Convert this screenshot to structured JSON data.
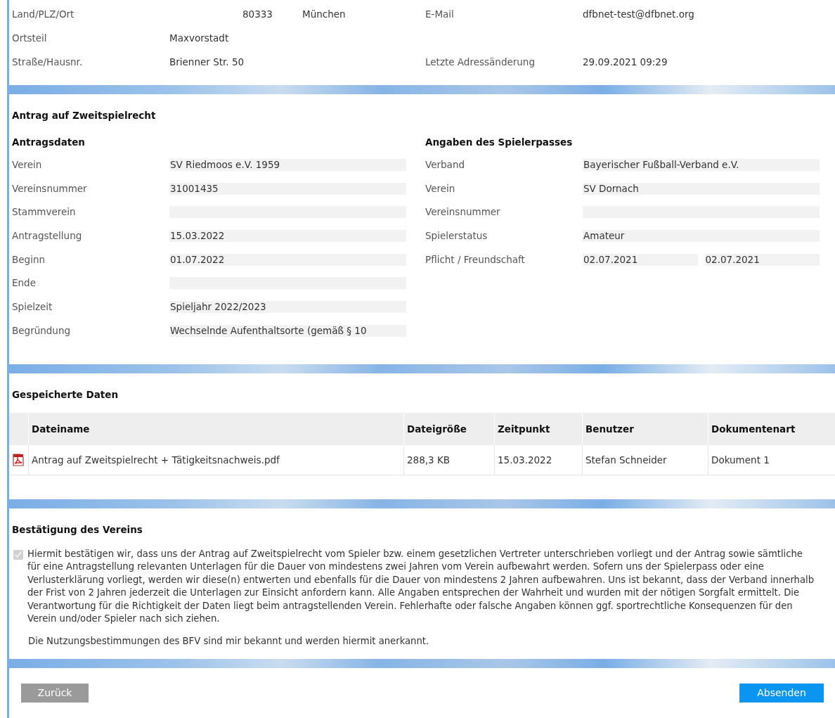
{
  "address": {
    "rows": [
      {
        "left": {
          "label": "Land/PLZ/Ort",
          "kind": "location",
          "zip": "80333",
          "city": "München"
        },
        "right": {
          "label": "E-Mail",
          "value": "dfbnet-test@dfbnet.org"
        }
      },
      {
        "left": {
          "label": "Ortsteil",
          "kind": "text",
          "value": "Maxvorstadt"
        }
      },
      {
        "left": {
          "label": "Straße/Hausnr.",
          "kind": "text",
          "value": "Brienner Str. 50"
        },
        "right": {
          "label": "Letzte Adressänderung",
          "value": "29.09.2021 09:29"
        }
      }
    ]
  },
  "application": {
    "title": "Antrag auf Zweitspielrecht",
    "columns": [
      {
        "heading": "Antragsdaten",
        "fields": [
          {
            "label": "Verein",
            "values": [
              "SV Riedmoos e.V. 1959"
            ]
          },
          {
            "label": "Vereinsnummer",
            "values": [
              "31001435"
            ]
          },
          {
            "label": "Stammverein"
          },
          {
            "label": "Antragstellung",
            "values": [
              "15.03.2022"
            ]
          },
          {
            "label": "Beginn",
            "values": [
              "01.07.2022"
            ]
          },
          {
            "label": "Ende"
          },
          {
            "label": "Spielzeit",
            "values": [
              "Spieljahr 2022/2023"
            ]
          },
          {
            "label": "Begründung",
            "values": [
              "Wechselnde Aufenthaltsorte (gemäß § 10"
            ]
          }
        ]
      },
      {
        "heading": "Angaben des Spielerpasses",
        "fields": [
          {
            "label": "Verband",
            "values": [
              "Bayerischer Fußball-Verband e.V."
            ]
          },
          {
            "label": "Verein",
            "values": [
              "SV Dornach"
            ]
          },
          {
            "label": "Vereinsnummer"
          },
          {
            "label": "Spielerstatus",
            "values": [
              "Amateur"
            ]
          },
          {
            "label": "Pflicht / Freundschaft",
            "values": [
              "02.07.2021",
              "02.07.2021"
            ]
          }
        ]
      }
    ]
  },
  "stored_data": {
    "title": "Gespeicherte Daten",
    "table": {
      "columns": [
        "Dateiname",
        "Dateigröße",
        "Zeitpunkt",
        "Benutzer",
        "Dokumentenart"
      ],
      "rows": [
        {
          "kind": "pdf",
          "cells": [
            "Antrag auf Zweitspielrecht + Tätigkeitsnachweis.pdf",
            "288,3 KB",
            "15.03.2022",
            "Stefan Schneider",
            "Dokument 1"
          ]
        }
      ]
    }
  },
  "confirmation": {
    "title": "Bestätigung des Vereins",
    "checkbox": {
      "checked": true,
      "disabled": true,
      "text": "Hiermit bestätigen wir, dass uns der Antrag auf Zweitspielrecht vom Spieler bzw. einem gesetzlichen Vertreter unterschrieben vorliegt und der Antrag sowie sämtliche für eine Antragstellung relevanten Unterlagen für die Dauer von mindestens zwei Jahren vom Verein aufbewahrt werden. Sofern uns der Spielerpass oder eine Verlusterklärung vorliegt, werden wir diese(n) entwerten und ebenfalls für die Dauer von mindestens 2 Jahren aufbewahren. Uns ist bekannt, dass der Verband innerhalb der Frist von 2 Jahren jederzeit die Unterlagen zur Einsicht anfordern kann. Alle Angaben entsprechen der Wahrheit und wurden mit der nötigen Sorgfalt ermittelt. Die Verantwortung für die Richtigkeit der Daten liegt beim antragstellenden Verein. Fehlerhafte oder falsche Angaben können ggf. sportrechtliche Konsequenzen für den Verein und/oder Spieler nach sich ziehen."
    },
    "note": "Die Nutzungsbestimmungen des BFV sind mir bekannt und werden hiermit anerkannt."
  },
  "buttons": [
    {
      "label": "Zurück",
      "kind": "secondary"
    },
    {
      "label": "Absenden",
      "kind": "primary"
    }
  ]
}
